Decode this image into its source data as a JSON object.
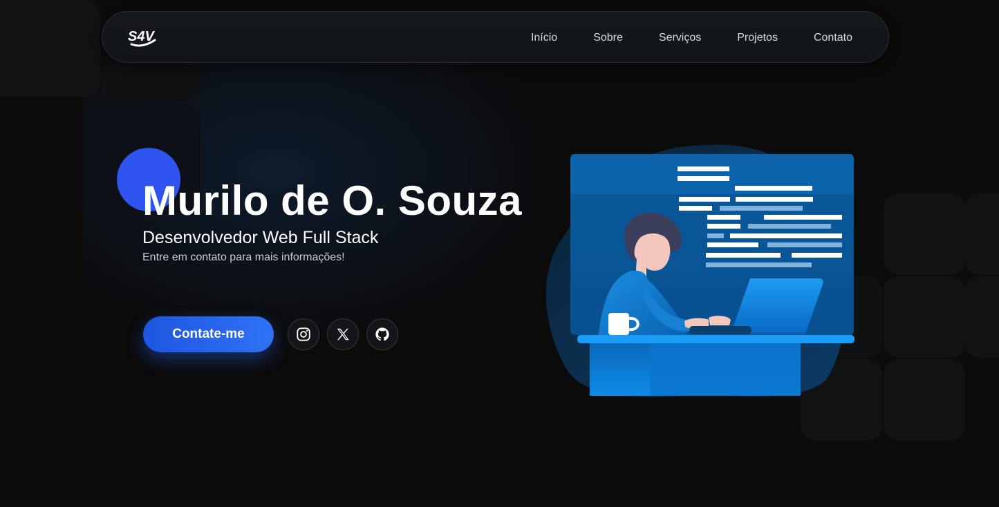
{
  "nav": {
    "logo_text": "S4V",
    "links": [
      "Início",
      "Sobre",
      "Serviços",
      "Projetos",
      "Contato"
    ]
  },
  "hero": {
    "name": "Murilo de O. Souza",
    "role": "Desenvolvedor Web Full Stack",
    "subtitle": "Entre em contato para mais informações!",
    "cta_label": "Contate-me"
  },
  "social": [
    {
      "icon": "instagram-icon"
    },
    {
      "icon": "x-icon"
    },
    {
      "icon": "github-icon"
    }
  ],
  "colors": {
    "background": "#0b0b0c",
    "accent": "#2f72f5",
    "accent_dot": "#2e55f0"
  }
}
